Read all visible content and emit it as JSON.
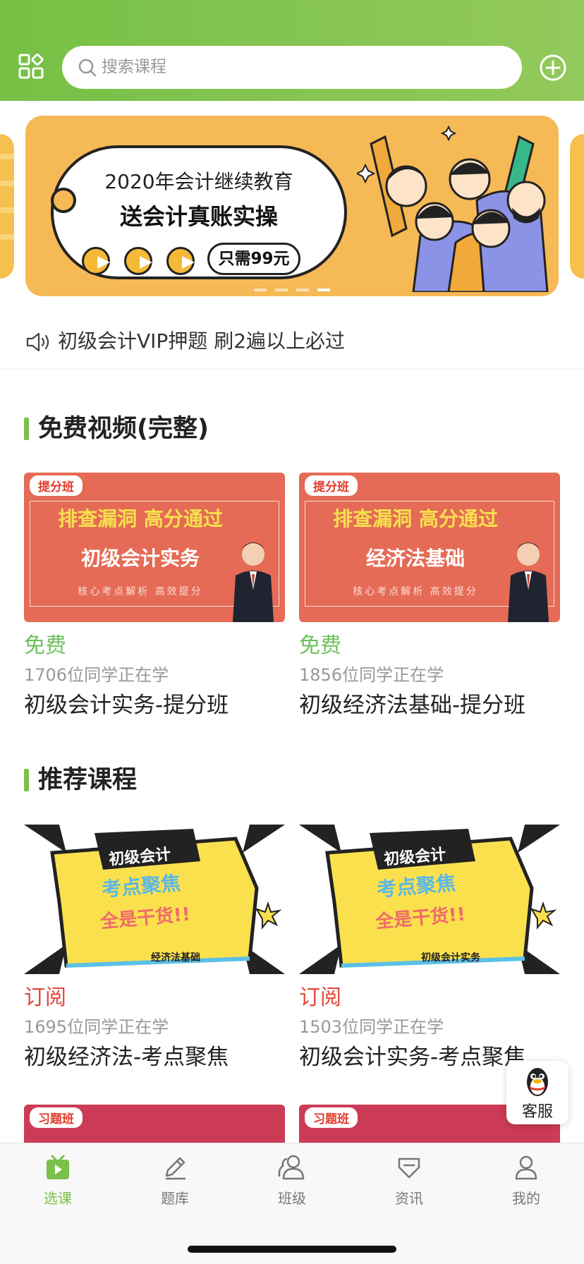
{
  "header": {
    "search_placeholder": "搜索课程",
    "gradient_start": "#76c045",
    "gradient_end": "#93c95c"
  },
  "banner": {
    "line1": "2020年会计继续教育",
    "line2": "送会计真账实操",
    "price": "只需99元",
    "slide_count": 4,
    "active_slide": 4
  },
  "announcement": {
    "text": "初级会计VIP押题 刷2遍以上必过"
  },
  "sections": [
    {
      "title": "免费视频(完整)",
      "cards": [
        {
          "thumb_tag": "提分班",
          "thumb_line1": "排查漏洞 高分通过",
          "thumb_line2": "初级会计实务",
          "thumb_line3": "核心考点解析 高效提分",
          "price": "免费",
          "learners": "1706位同学正在学",
          "title": "初级会计实务-提分班"
        },
        {
          "thumb_tag": "提分班",
          "thumb_line1": "排查漏洞 高分通过",
          "thumb_line2": "经济法基础",
          "thumb_line3": "核心考点解析 高效提分",
          "price": "免费",
          "learners": "1856位同学正在学",
          "title": "初级经济法基础-提分班"
        }
      ]
    },
    {
      "title": "推荐课程",
      "cards": [
        {
          "thumb_line1": "初级会计",
          "thumb_line2": "考点聚焦",
          "thumb_line3": "全是干货!!",
          "thumb_line4": "经济法基础",
          "price": "订阅",
          "learners": "1695位同学正在学",
          "title": "初级经济法-考点聚焦"
        },
        {
          "thumb_line1": "初级会计",
          "thumb_line2": "考点聚焦",
          "thumb_line3": "全是干货!!",
          "thumb_line4": "初级会计实务",
          "price": "订阅",
          "learners": "1503位同学正在学",
          "title": "初级会计实务-考点聚焦"
        }
      ]
    }
  ],
  "partial_cards": [
    {
      "thumb_tag": "习题班"
    },
    {
      "thumb_tag": "习题班"
    }
  ],
  "customer_service": {
    "label": "客服"
  },
  "tabs": [
    {
      "label": "选课",
      "icon": "tv-play-icon",
      "active": true
    },
    {
      "label": "题库",
      "icon": "pencil-icon",
      "active": false
    },
    {
      "label": "班级",
      "icon": "class-people-icon",
      "active": false
    },
    {
      "label": "资讯",
      "icon": "news-diamond-icon",
      "active": false
    },
    {
      "label": "我的",
      "icon": "user-icon",
      "active": false
    }
  ],
  "colors": {
    "accent_green": "#7bc04a",
    "free_green": "#6cc05a",
    "subscribe_red": "#e0473a",
    "banner_orange": "#f5b955"
  }
}
